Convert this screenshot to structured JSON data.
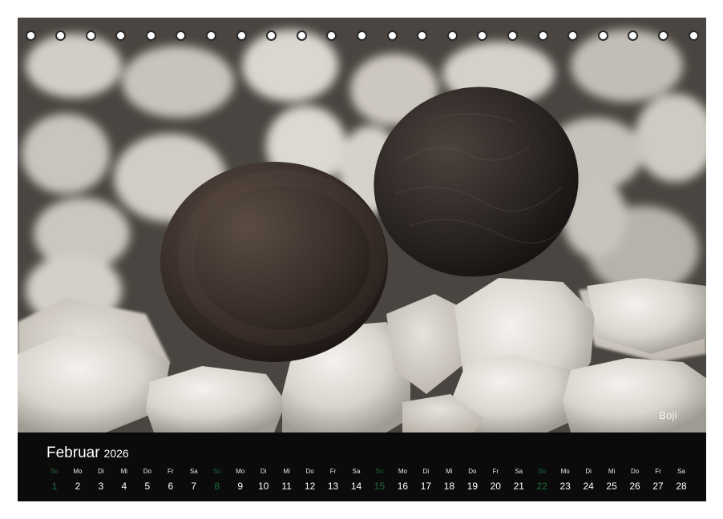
{
  "photo": {
    "credit": "Boji",
    "hole_count": 23
  },
  "calendar": {
    "month": "Februar",
    "year": "2026",
    "weekdays": [
      "So",
      "Mo",
      "Di",
      "Mi",
      "Do",
      "Fr",
      "Sa",
      "So",
      "Mo",
      "Di",
      "Mi",
      "Do",
      "Fr",
      "Sa",
      "So",
      "Mo",
      "Di",
      "Mi",
      "Do",
      "Fr",
      "Sa",
      "So",
      "Mo",
      "Di",
      "Mi",
      "Do",
      "Fr",
      "Sa"
    ],
    "days": [
      "1",
      "2",
      "3",
      "4",
      "5",
      "6",
      "7",
      "8",
      "9",
      "10",
      "11",
      "12",
      "13",
      "14",
      "15",
      "16",
      "17",
      "18",
      "19",
      "20",
      "21",
      "22",
      "23",
      "24",
      "25",
      "26",
      "27",
      "28"
    ],
    "sunday_color": "#1f6b3a",
    "background_color": "#0b0b0b"
  }
}
